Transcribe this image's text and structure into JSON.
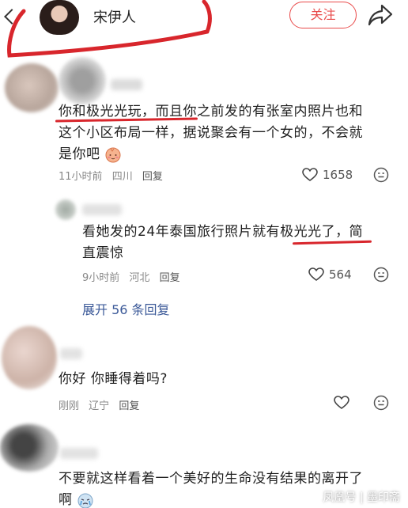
{
  "header": {
    "username": "宋伊人",
    "follow_label": "关注"
  },
  "comments": [
    {
      "text_line1": "你和极光光玩，而且你之前发的有张室内照片也和",
      "text_line2": "这个小区布局一样，据说聚会有一个女的，不会就",
      "text_line3": "是你吧",
      "time": "11小时前",
      "location": "四川",
      "reply_label": "回复",
      "likes": "1658"
    },
    {
      "text_line1": "看她发的24年泰国旅行照片就有极光光了，简",
      "text_line2": "直震惊",
      "time": "9小时前",
      "location": "河北",
      "reply_label": "回复",
      "likes": "564"
    },
    {
      "text": "你好 你睡得着吗?",
      "time": "刚刚",
      "location": "辽宁",
      "reply_label": "回复"
    },
    {
      "text_line1": "不要就这样看着一个美好的生命没有结果的离开了",
      "text_line2": "啊"
    }
  ],
  "expand_label": "展开 56 条回复",
  "watermark": "凤凰号 | 墨印斋",
  "colors": {
    "accent": "#e94b4b",
    "link": "#3b5998",
    "marker": "#d8262c"
  },
  "icons": [
    "back-arrow-icon",
    "share-icon",
    "heart-icon",
    "emoji-comment-icon",
    "shy-face-emoji"
  ]
}
